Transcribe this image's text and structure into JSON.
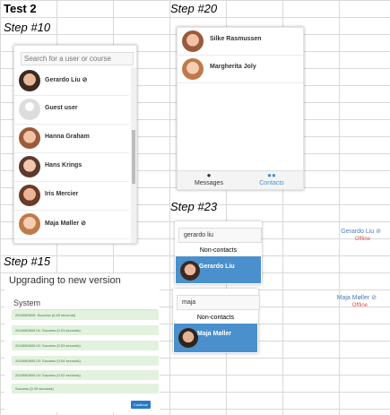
{
  "sheet": {
    "title": "Test 2",
    "labels": {
      "step10": "Step #10",
      "step20": "Step #20",
      "step23": "Step #23",
      "step15": "Step #15"
    }
  },
  "step10": {
    "search_placeholder": "Search for a user or course",
    "users": [
      {
        "name": "Gerardo Liu ⊘",
        "avatar": "user-avatar"
      },
      {
        "name": "Guest user",
        "avatar": "default-avatar"
      },
      {
        "name": "Hanna Graham",
        "avatar": "user-avatar"
      },
      {
        "name": "Hans Krings",
        "avatar": "user-avatar"
      },
      {
        "name": "Iris Mercier",
        "avatar": "user-avatar"
      },
      {
        "name": "Maja Møller ⊘",
        "avatar": "user-avatar"
      }
    ]
  },
  "step20": {
    "contacts": [
      {
        "name": "Silke Rasmussen"
      },
      {
        "name": "Margherita Joly"
      }
    ],
    "tabs": {
      "messages": "Messages",
      "contacts": "Contacts"
    },
    "icons": {
      "messages": "chat-icon",
      "contacts": "people-icon"
    }
  },
  "step23": {
    "block1": {
      "search_value": "gerardo liu",
      "section_label": "Non-contacts",
      "result_name": "Gerardo Liu",
      "profile_name": "Gerardo Liu ⊘",
      "profile_status": "Offline"
    },
    "block2": {
      "search_value": "maja",
      "section_label": "Non-contacts",
      "result_name": "Maja Møller",
      "profile_name": "Maja Møller ⊘",
      "profile_status": "Offline"
    }
  },
  "step15": {
    "heading": "Upgrading to new version",
    "section": "System",
    "logs": [
      "2018050600: Success (0.48 seconds)",
      "2018050600.01: Success (0.03 seconds)",
      "2018050600.02: Success (0.03 seconds)",
      "2018050600.03: Success (0.04 seconds)",
      "2018050600.04: Success (0.02 seconds)",
      "Success (0.19 seconds)"
    ],
    "continue_label": "Continue"
  },
  "colors": {
    "accent": "#4a90cc",
    "success_bg": "#e3f1df",
    "offline": "#e05050",
    "button": "#2a7ac6"
  }
}
